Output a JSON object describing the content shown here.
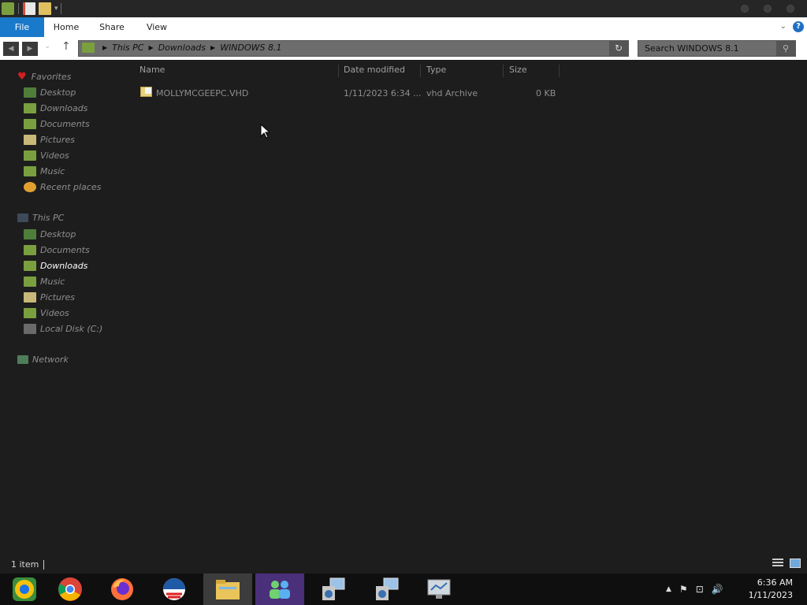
{
  "window": {
    "title": "WINDOWS 8.1"
  },
  "ribbon": {
    "tabs": [
      {
        "label": "File"
      },
      {
        "label": "Home"
      },
      {
        "label": "Share"
      },
      {
        "label": "View"
      }
    ],
    "help_label": "?"
  },
  "address": {
    "crumbs": [
      "This PC",
      "Downloads",
      "WINDOWS 8.1"
    ]
  },
  "search": {
    "placeholder": "Search WINDOWS 8.1"
  },
  "sidebar": {
    "favorites_label": "Favorites",
    "favorites": [
      "Desktop",
      "Downloads",
      "Documents",
      "Pictures",
      "Videos",
      "Music",
      "Recent places"
    ],
    "thispc_label": "This PC",
    "thispc": [
      "Desktop",
      "Documents",
      "Downloads",
      "Music",
      "Pictures",
      "Videos",
      "Local Disk (C:)"
    ],
    "selected": "Downloads",
    "network_label": "Network"
  },
  "columns": {
    "name": "Name",
    "date": "Date modified",
    "type": "Type",
    "size": "Size"
  },
  "files": [
    {
      "name": "MOLLYMCGEEPC.VHD",
      "date": "1/11/2023 6:34 ...",
      "type": "vhd Archive",
      "size": "0 KB"
    }
  ],
  "status": {
    "items": "1 item"
  },
  "clock": {
    "time": "6:36 AM",
    "date": "1/11/2023"
  },
  "taskbar": {
    "apps": [
      "chrome-remote-icon",
      "chrome-icon",
      "firefox-icon",
      "obama-logo-icon",
      "file-explorer-icon",
      "people-icon",
      "network-setup-icon",
      "network-setup-icon-2",
      "monitor-icon"
    ]
  },
  "colors": {
    "accent": "#1979ca",
    "background": "#1d1d1d",
    "taskbar": "#0f0f0f"
  }
}
